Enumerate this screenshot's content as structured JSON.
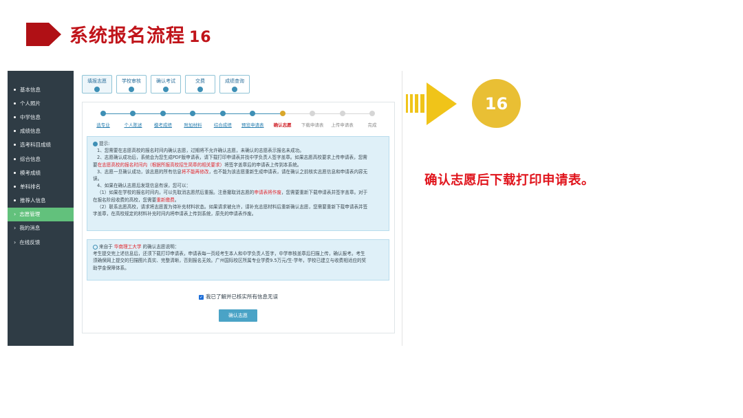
{
  "slide": {
    "title": "系统报名流程",
    "number": "16",
    "badge": "16",
    "note": "确认志愿后下载打印申请表。"
  },
  "sidebar": {
    "items": [
      {
        "label": "基本信息",
        "type": "bullet"
      },
      {
        "label": "个人照片",
        "type": "bullet"
      },
      {
        "label": "中学信息",
        "type": "bullet"
      },
      {
        "label": "成绩信息",
        "type": "bullet"
      },
      {
        "label": "选考科目成绩",
        "type": "bullet"
      },
      {
        "label": "综合信息",
        "type": "bullet"
      },
      {
        "label": "模考成绩",
        "type": "bullet"
      },
      {
        "label": "单科排名",
        "type": "bullet"
      },
      {
        "label": "推荐人信息",
        "type": "bullet"
      },
      {
        "label": "志愿管理",
        "type": "section",
        "active": true
      },
      {
        "label": "我的消息",
        "type": "section"
      },
      {
        "label": "在线反馈",
        "type": "section"
      }
    ]
  },
  "tabs": [
    {
      "label": "填报志愿",
      "active": true
    },
    {
      "label": "学校审核"
    },
    {
      "label": "确认考试"
    },
    {
      "label": "交费"
    },
    {
      "label": "成绩查询"
    }
  ],
  "steps": [
    {
      "label": "选专业",
      "state": "done"
    },
    {
      "label": "个人陈述",
      "state": "done"
    },
    {
      "label": "模考成绩",
      "state": "done"
    },
    {
      "label": "附加材料",
      "state": "done"
    },
    {
      "label": "综合成绩",
      "state": "done"
    },
    {
      "label": "预览申请表",
      "state": "done"
    },
    {
      "label": "确认志愿",
      "state": "current"
    },
    {
      "label": "下载申请表",
      "state": "todo"
    },
    {
      "label": "上传申请表",
      "state": "todo"
    },
    {
      "label": "完成",
      "state": "todo"
    }
  ],
  "tips": {
    "title": "提示:",
    "line1": "1、您需要在志愿高校的报名时间内确认志愿，过期将不允许确认志愿，未确认的志愿表示报名未成功。",
    "line2a": "2、志愿确认成功后，系统会为您生成PDF版申请表，请下载打印申请表并找中学负责人签字盖章。如果志愿高校要求上传申请表，您需",
    "line2b_pre": "要",
    "line2b_red": "在志愿高校的报名时间内（根据所报高校招生简章的相关要求）",
    "line2b_post": "将签字盖章后的申请表上传到本系统。",
    "line3a_pre": "3、志愿一旦确认成功，该志愿的所有信息",
    "line3a_red": "将不能再修改",
    "line3a_post": "，也不能为该志愿重新生成申请表，请在确认之前核实志愿信息和申请表内容无",
    "line3b": "误。",
    "line4": "4、如果在确认志愿后发现信息有误，您可以：",
    "line5a_pre": "（1）如果在学校的报名时间内，可以先取消志愿然后重报。注意撤取消志愿的",
    "line5a_red": "申请表将作废",
    "line5a_post": "，您需要重新下载申请表并签字盖章。对于",
    "line5b_pre": "在报名阶段收费的高校，您需要",
    "line5b_red": "重新缴费",
    "line5b_post": "。",
    "line6a": "（2）联系志愿高校，请求将志愿置为待补充材料状态。如果请求被允许，请补充志愿材料后重新确认志愿，您需要重新下载申请表并签",
    "line6b": "字盖章，在高校规定的材料补充时间内将申请表上传到系统，原先的申请表作废。"
  },
  "school_note": {
    "prefix": "来自于 ",
    "school": "华南理工大学",
    "suffix": " 的确认志愿说明：",
    "line1": "考生提交完上述信息后，还须下载打印申请表，申请表每一页经考生本人和中学负责人签字，中学审核盖章后扫描上传，确认报考。考生",
    "line2": "须确保网上提交的扫描图片真实、完整清晰，否则报名无效。广州国际校区所属专业学费9.5万元/生·学年，学校已建立与收费相适应的奖",
    "line3": "助学金保障体系。"
  },
  "agree_text": "我已了解并已核实所有信息无误",
  "confirm_button": "确认志愿",
  "colors": {
    "title_red": "#c0141a",
    "accent_green": "#62c17c",
    "badge_yellow": "#e9bf34",
    "step_blue": "#3e8fb5",
    "step_current": "#d9a72b"
  }
}
